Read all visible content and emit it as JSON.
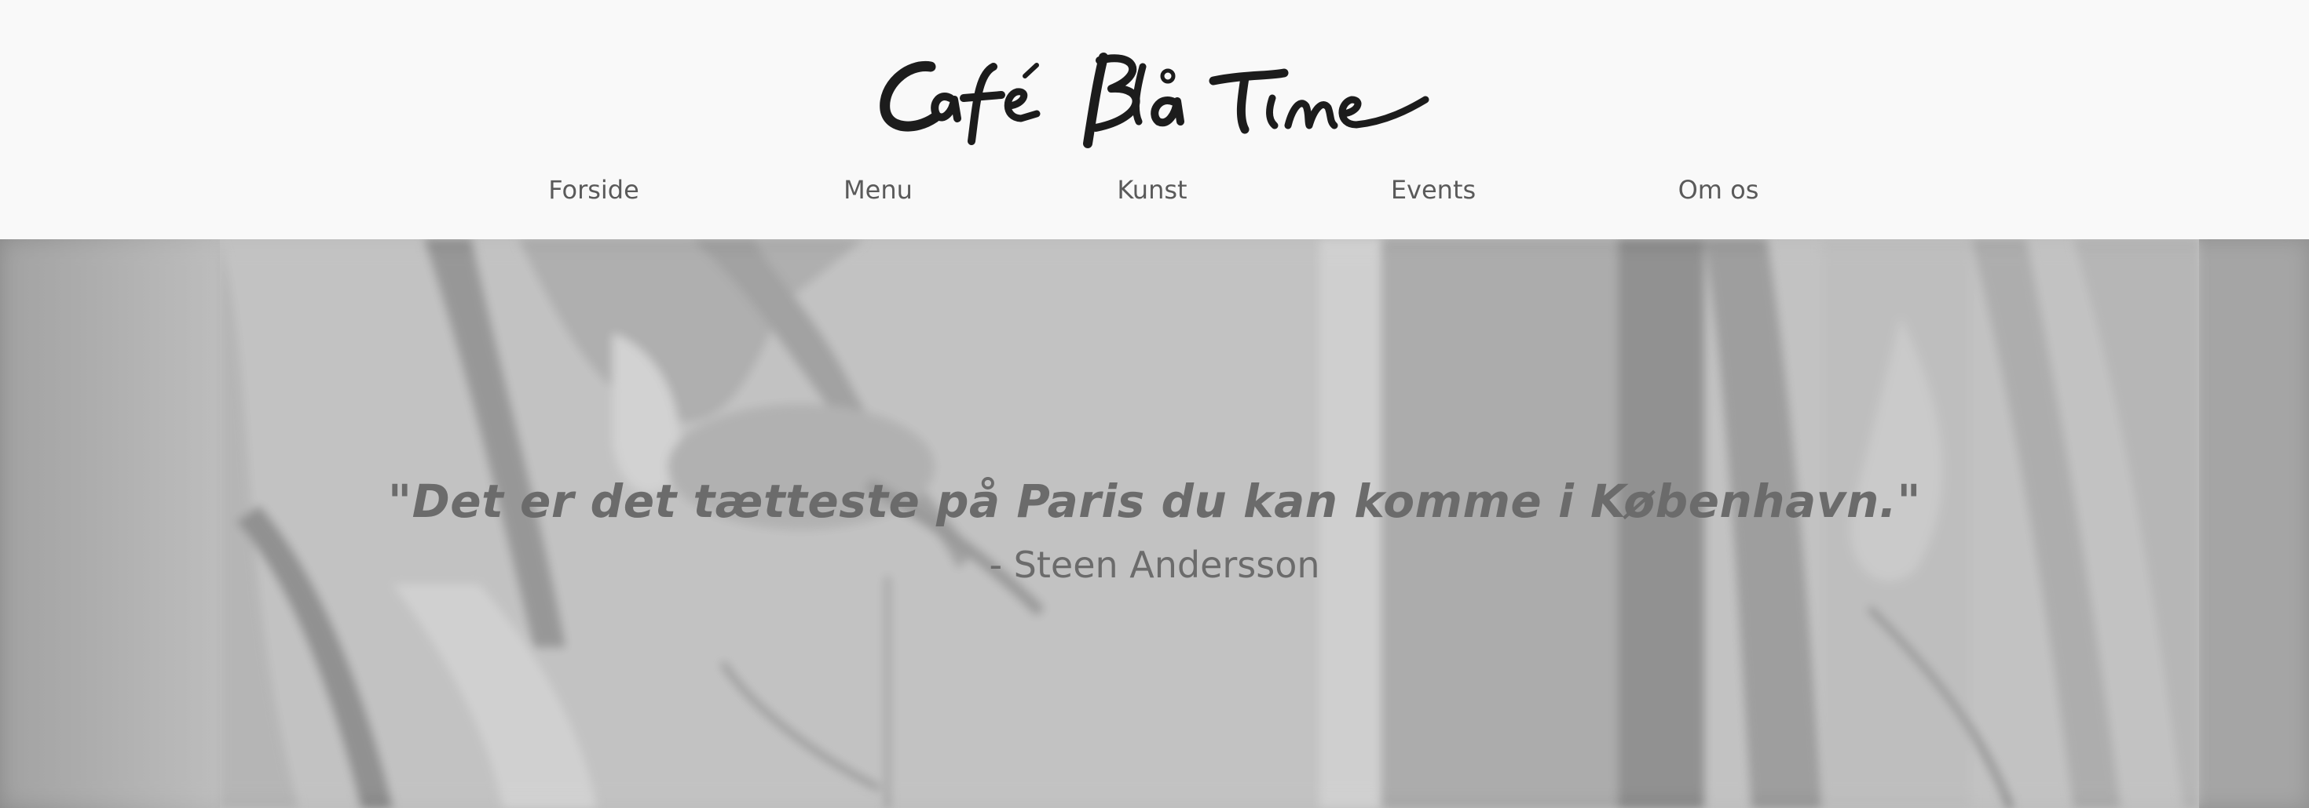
{
  "header": {
    "logo_text": "Café Blå Time",
    "nav": [
      {
        "label": "Forside"
      },
      {
        "label": "Menu"
      },
      {
        "label": "Kunst"
      },
      {
        "label": "Events"
      },
      {
        "label": "Om os"
      }
    ]
  },
  "hero": {
    "quote": "\"Det er det tætteste på Paris du kan komme i København.\"",
    "author": "- Steen Andersson"
  },
  "colors": {
    "header_bg": "#f9f9f9",
    "nav_text": "#5a5a5a",
    "hero_text": "#6b6b6b",
    "hero_overlay": "#8f8f8f"
  }
}
